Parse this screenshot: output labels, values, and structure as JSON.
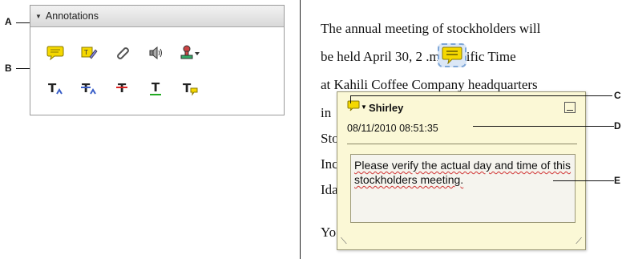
{
  "callouts": {
    "a": "A",
    "b": "B",
    "c": "C",
    "d": "D",
    "e": "E"
  },
  "panel": {
    "title": "Annotations",
    "row1_icons": [
      "sticky-note-icon",
      "text-edit-icon",
      "attach-file-icon",
      "record-audio-icon",
      "add-stamp-icon"
    ],
    "row2_icons": [
      "insert-text-icon",
      "replace-text-icon",
      "strikethrough-icon",
      "underline-icon",
      "add-note-to-text-icon"
    ]
  },
  "document": {
    "lines": [
      "The annual meeting of stockholders will",
      "be held April 30, 2           .m. Pacific Time",
      "at Kahili Coffee Company headquarters",
      "in",
      "Sto",
      "Inc",
      "Ida",
      "",
      "Yo"
    ]
  },
  "note": {
    "author": "Shirley",
    "date": "08/11/2010 08:51:35",
    "text": "Please verify the actual day and time of this stockholders meeting."
  },
  "colors": {
    "note_bg": "#fbf8d6",
    "note_icon": "#f5d800",
    "selection": "#7fa7d8"
  }
}
